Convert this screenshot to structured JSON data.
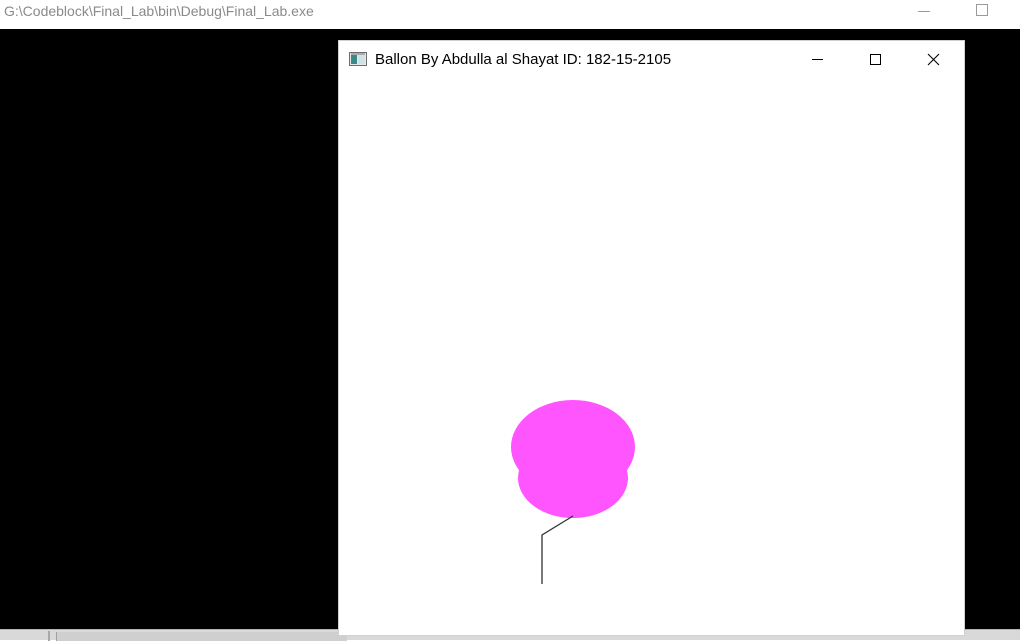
{
  "console": {
    "title": "G:\\Codeblock\\Final_Lab\\bin\\Debug\\Final_Lab.exe"
  },
  "gl_window": {
    "title": "Ballon By Abdulla al Shayat ID: 182-15-2105"
  },
  "scene": {
    "balloon_color": "#ff55ff",
    "string_color": "#333333",
    "background_color": "#ffffff"
  },
  "icons": {
    "app": "opengl-window-icon",
    "minimize": "minimize-icon",
    "maximize": "maximize-icon",
    "close": "close-icon"
  }
}
